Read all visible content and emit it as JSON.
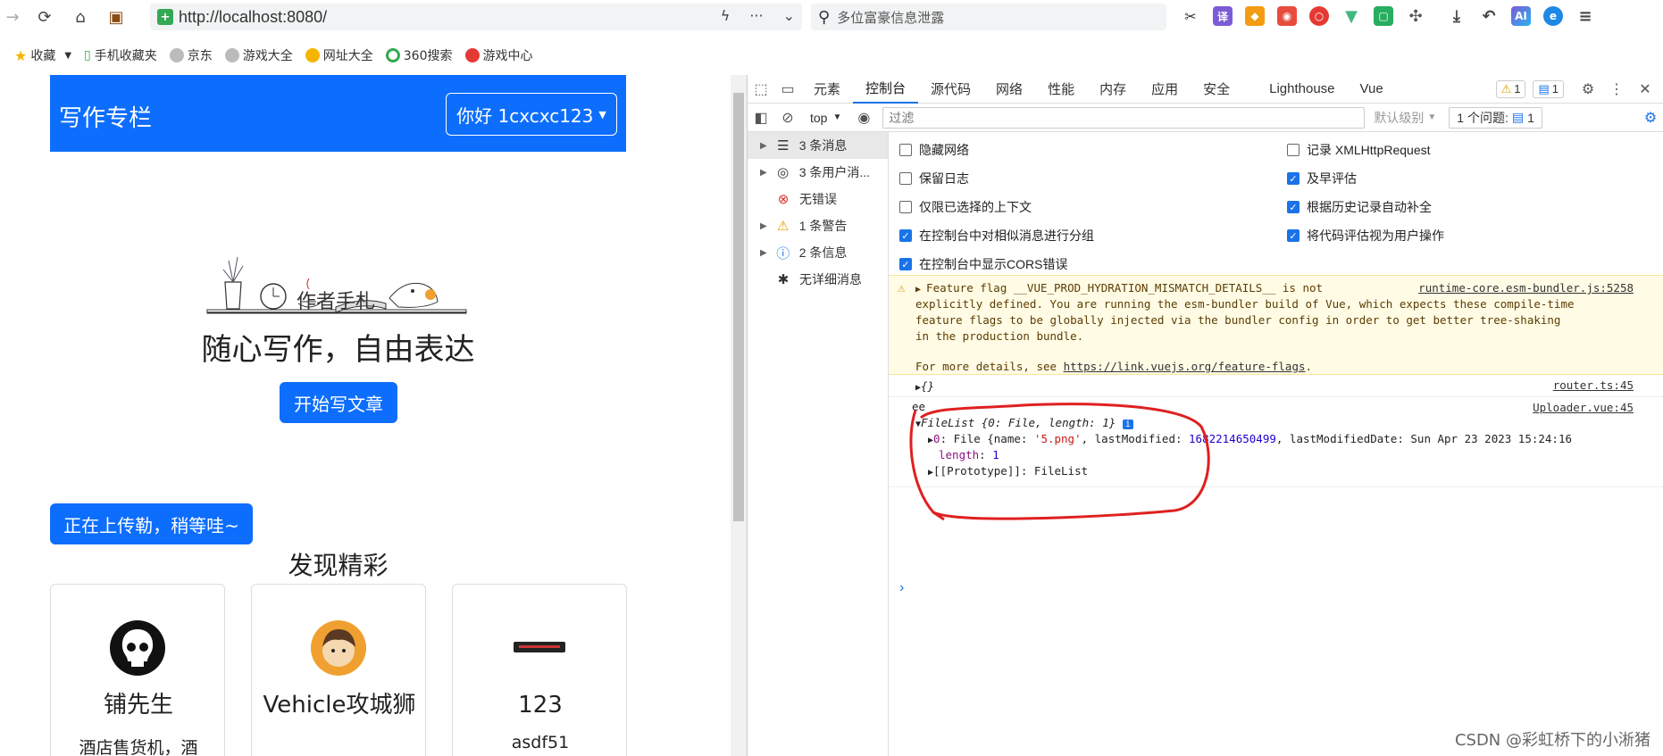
{
  "browser": {
    "url": "http://localhost:8080/",
    "search_placeholder": "多位富豪信息泄露"
  },
  "bookmarks": [
    {
      "label": "收藏",
      "icon": "star-icon"
    },
    {
      "label": "手机收藏夹",
      "icon": "phone-icon"
    },
    {
      "label": "京东",
      "icon": "globe-icon"
    },
    {
      "label": "游戏大全",
      "icon": "globe-icon"
    },
    {
      "label": "网址大全",
      "icon": "compass-icon"
    },
    {
      "label": "360搜索",
      "icon": "search-icon"
    },
    {
      "label": "游戏中心",
      "icon": "game-icon"
    }
  ],
  "page": {
    "brand": "写作专栏",
    "user_button": "你好 1cxcxc123",
    "illustration_text": "作者手札",
    "slogan": "随心写作，自由表达",
    "start_button": "开始写文章",
    "upload_button": "正在上传勒，稍等哇~",
    "discover_title": "发现精彩",
    "cards": [
      {
        "name": "铺先生",
        "desc": "酒店售货机，酒"
      },
      {
        "name": "Vehicle攻城狮",
        "desc": ""
      },
      {
        "name": "123",
        "desc": "asdf51"
      }
    ]
  },
  "devtools": {
    "tabs": [
      "元素",
      "控制台",
      "源代码",
      "网络",
      "性能",
      "内存",
      "应用",
      "安全",
      "Lighthouse",
      "Vue"
    ],
    "active_tab": "控制台",
    "warn_count": "1",
    "msg_count": "1",
    "context": "top",
    "filter_placeholder": "过滤",
    "level": "默认级别",
    "issues_label": "1 个问题:",
    "issues_count": "1",
    "sidebar": [
      {
        "label": "3 条消息",
        "icon": "list-icon"
      },
      {
        "label": "3 条用户消...",
        "icon": "user-icon"
      },
      {
        "label": "无错误",
        "icon": "error-icon"
      },
      {
        "label": "1 条警告",
        "icon": "warning-icon"
      },
      {
        "label": "2 条信息",
        "icon": "info-icon"
      },
      {
        "label": "无详细消息",
        "icon": "bug-icon"
      }
    ],
    "settings_left": [
      {
        "label": "隐藏网络",
        "checked": false
      },
      {
        "label": "保留日志",
        "checked": false
      },
      {
        "label": "仅限已选择的上下文",
        "checked": false
      },
      {
        "label": "在控制台中对相似消息进行分组",
        "checked": true
      },
      {
        "label": "在控制台中显示CORS错误",
        "checked": true
      }
    ],
    "settings_right": [
      {
        "label": "记录 XMLHttpRequest",
        "checked": false
      },
      {
        "label": "及早评估",
        "checked": true
      },
      {
        "label": "根据历史记录自动补全",
        "checked": true
      },
      {
        "label": "将代码评估视为用户操作",
        "checked": true
      }
    ],
    "warning": {
      "lines": [
        "Feature flag __VUE_PROD_HYDRATION_MISMATCH_DETAILS__ is not",
        "explicitly defined. You are running the esm-bundler build of Vue, which expects these compile-time",
        "feature flags to be globally injected via the bundler config in order to get better tree-shaking",
        "in the production bundle."
      ],
      "more_prefix": "For more details, see ",
      "more_link": "https://link.vuejs.org/feature-flags",
      "more_suffix": ".",
      "source": "runtime-core.esm-bundler.js:5258"
    },
    "log1": {
      "text": "{}",
      "source": "router.ts:45"
    },
    "log2": {
      "label": "ee",
      "source": "Uploader.vue:45",
      "filelist": "FileList {0: File, length: 1}",
      "item0_key": "0",
      "item0_prefix": ": File {name: ",
      "item0_name": "'5.png'",
      "item0_mid": ", lastModified: ",
      "item0_lm": "1682214650499",
      "item0_suffix": ", lastModifiedDate: Sun Apr 23 2023 15:24:16",
      "length_key": "length",
      "length_val": "1",
      "proto": "[[Prototype]]: FileList"
    }
  },
  "watermark": "CSDN @彩虹桥下的小淅猪",
  "colors": {
    "primary": "#0d6efd",
    "devtools_blue": "#1a73e8",
    "annotation_red": "#e02020"
  }
}
